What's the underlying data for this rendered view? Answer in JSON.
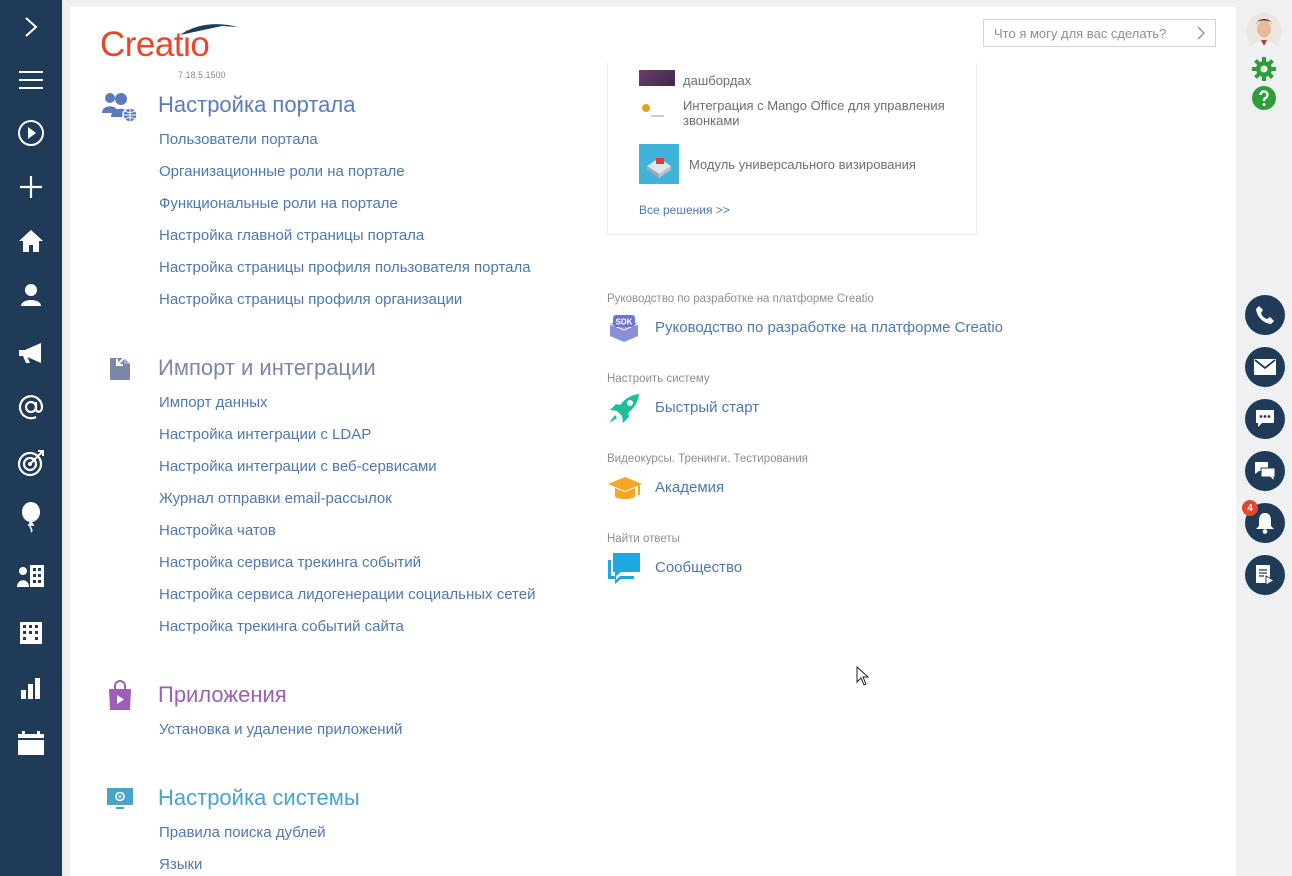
{
  "app": {
    "logo_text": "Creatio",
    "version": "7.18.5.1500",
    "brand_color": "#e8462a",
    "nav_color": "#1f3b58"
  },
  "left_nav": {
    "icons": [
      "chevron-right-icon",
      "menu-icon",
      "play-icon",
      "plus-icon",
      "home-icon",
      "person-icon",
      "megaphone-icon",
      "at-sign-icon",
      "target-icon",
      "balloon-icon",
      "contacts-building-icon",
      "building-icon",
      "bar-chart-icon",
      "calendar-icon"
    ]
  },
  "search": {
    "placeholder": "Что я могу для вас сделать?"
  },
  "sections": {
    "portal": {
      "title": "Настройка портала",
      "color": "#5b7bbd",
      "links": [
        "Пользователи портала",
        "Организационные роли на портале",
        "Функциональные роли на портале",
        "Настройка главной страницы портала",
        "Настройка страницы профиля пользователя портала",
        "Настройка страницы профиля организации"
      ]
    },
    "import": {
      "title": "Импорт и интеграции",
      "color": "#7b86a8",
      "links": [
        "Импорт данных",
        "Настройка интеграции с LDAP",
        "Настройка интеграции с веб-сервисами",
        "Журнал отправки email-рассылок",
        "Настройка чатов",
        "Настройка сервиса трекинга событий",
        "Настройка сервиса лидогенерации социальных сетей",
        "Настройка трекинга событий сайта"
      ]
    },
    "apps": {
      "title": "Приложения",
      "color": "#9b5fb5",
      "links": [
        "Установка и удаление приложений"
      ]
    },
    "system": {
      "title": "Настройка системы",
      "color": "#4aa3c8",
      "links": [
        "Правила поиска дублей",
        "Языки"
      ]
    }
  },
  "solutions": {
    "items": [
      "дашбордах",
      "Интеграция с Mango Office для управления звонками",
      "Модуль универсального визирования"
    ],
    "all_label": "Все решения >>"
  },
  "resources": [
    {
      "caption": "Руководство по разработке на платформе Creatio",
      "link": "Руководство по разработке на платформе Creatio",
      "icon": "sdk-icon"
    },
    {
      "caption": "Настроить систему",
      "link": "Быстрый старт",
      "icon": "rocket-icon"
    },
    {
      "caption": "Видеокурсы. Тренинги. Тестирования",
      "link": "Академия",
      "icon": "graduation-cap-icon"
    },
    {
      "caption": "Найти ответы",
      "link": "Сообщество",
      "icon": "chat-bubbles-icon"
    }
  ],
  "right_panel": {
    "icons": [
      "avatar",
      "gear-icon",
      "help-icon",
      "phone-icon",
      "email-icon",
      "chat-icon",
      "messages-icon",
      "bell-icon",
      "document-play-icon"
    ],
    "notifications_count": "4"
  }
}
